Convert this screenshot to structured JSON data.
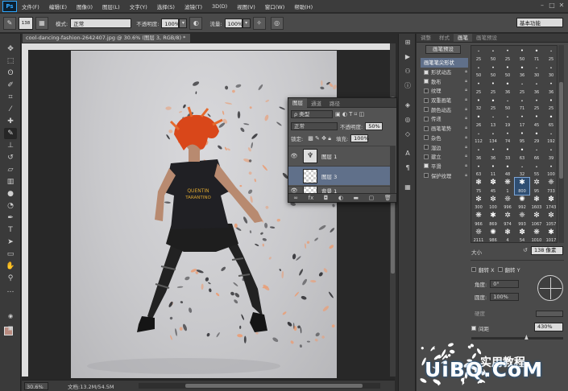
{
  "menubar": {
    "logo": "Ps",
    "items": [
      "文件(F)",
      "编辑(E)",
      "图像(I)",
      "图层(L)",
      "文字(Y)",
      "选择(S)",
      "滤镜(T)",
      "3D(D)",
      "视图(V)",
      "窗口(W)",
      "帮助(H)"
    ]
  },
  "options": {
    "brush_size": "138",
    "mode_label": "模式:",
    "mode_value": "正常",
    "opacity_label": "不透明度:",
    "opacity_value": "100%",
    "flow_label": "流量:",
    "flow_value": "100%",
    "workspace": "基本功能"
  },
  "document": {
    "tab_title": "cool-dancing-fashion-2642407.jpg @ 30.6% (图层 3, RGB/8) *",
    "zoom": "30.6%",
    "status": "文档:13.2M/54.5M",
    "shirt_text_1": "QUENTIN",
    "shirt_text_2": "TARANTINO"
  },
  "layers_panel": {
    "tabs": [
      "图层",
      "通道",
      "路径"
    ],
    "filter_label": "ρ 类型",
    "blend_mode": "正常",
    "opacity_label": "不透明度:",
    "opacity_value": "50%",
    "lock_label": "锁定:",
    "fill_label": "填充:",
    "fill_value": "100%",
    "layers": [
      {
        "name": "图层 1",
        "visible": true,
        "selected": false
      },
      {
        "name": "图层 3",
        "visible": false,
        "selected": true
      },
      {
        "name": "背景 1",
        "visible": true,
        "selected": false
      }
    ],
    "bottom_icons": [
      "link-icon",
      "fx-icon",
      "mask-icon",
      "adjustment-icon",
      "folder-icon",
      "new-layer-icon",
      "trash-icon"
    ]
  },
  "brush_panel": {
    "tabs": [
      "调整",
      "样式",
      "画笔",
      "画笔预设"
    ],
    "preset_button": "画笔预设",
    "options": [
      {
        "label": "画笔笔尖形状",
        "checked": null,
        "selected": true
      },
      {
        "label": "形状动态",
        "checked": true,
        "selected": false
      },
      {
        "label": "散布",
        "checked": true,
        "selected": false
      },
      {
        "label": "纹理",
        "checked": false,
        "selected": false
      },
      {
        "label": "双重画笔",
        "checked": false,
        "selected": false
      },
      {
        "label": "颜色动态",
        "checked": false,
        "selected": false
      },
      {
        "label": "传递",
        "checked": false,
        "selected": false
      },
      {
        "label": "画笔笔势",
        "checked": false,
        "selected": false
      },
      {
        "label": "杂色",
        "checked": false,
        "selected": false
      },
      {
        "label": "湿边",
        "checked": false,
        "selected": false
      },
      {
        "label": "建立",
        "checked": false,
        "selected": false
      },
      {
        "label": "平滑",
        "checked": true,
        "selected": false
      },
      {
        "label": "保护纹理",
        "checked": false,
        "selected": false
      }
    ],
    "tips": [
      "25",
      "50",
      "25",
      "50",
      "71",
      "25",
      "50",
      "50",
      "50",
      "36",
      "30",
      "30",
      "25",
      "25",
      "36",
      "25",
      "36",
      "36",
      "32",
      "25",
      "50",
      "71",
      "25",
      "25",
      "26",
      "13",
      "19",
      "17",
      "45",
      "65",
      "112",
      "134",
      "74",
      "95",
      "29",
      "192",
      "36",
      "36",
      "33",
      "63",
      "66",
      "39",
      "63",
      "11",
      "48",
      "32",
      "55",
      "100",
      "75",
      "45",
      "1",
      "800",
      "95",
      "733",
      "300",
      "100",
      "996",
      "992",
      "1603",
      "1743",
      "966",
      "869",
      "974",
      "993",
      "1067",
      "1057",
      "2111",
      "986",
      "4",
      "54",
      "1010",
      "1017"
    ],
    "selected_tip_index": 51,
    "size_label": "大小",
    "size_value": "138 像素",
    "flip_x": "翻转 X",
    "flip_y": "翻转 Y",
    "angle_label": "角度:",
    "angle_value": "0°",
    "roundness_label": "圆度:",
    "roundness_value": "100%",
    "hardness_label": "硬度",
    "spacing_label": "间距",
    "spacing_checked": true,
    "spacing_value": "430%",
    "spacing_fraction": 0.6
  },
  "watermark": {
    "cn": "实用教程",
    "en": "UiBQ.CoM"
  },
  "colors": {
    "foreground": "#b98b80",
    "background": "#ffffff",
    "accent": "#60708a",
    "hair": "#d9471a"
  }
}
